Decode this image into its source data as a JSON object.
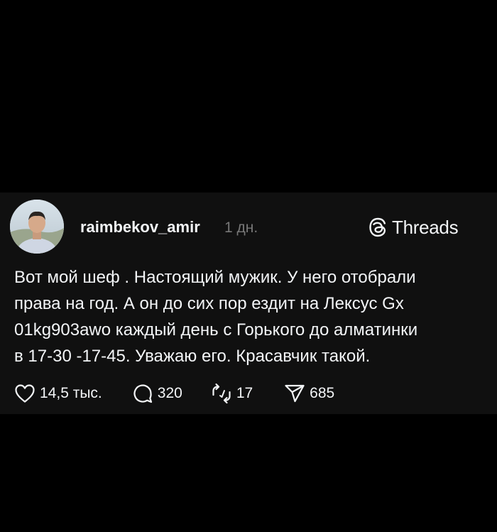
{
  "post": {
    "username": "raimbekov_amir",
    "time": "1 дн.",
    "brand": "Threads",
    "text_lines": [
      "Вот мой шеф . Настоящий мужик. У него отобрали",
      "права на год. А он до сих пор ездит на Лексус Gx",
      "01kg903awo каждый день с Горького до алматинки",
      "в 17-30 -17-45. Уважаю его. Красавчик такой."
    ],
    "stats": {
      "likes": "14,5 тыс.",
      "replies": "320",
      "reposts": "17",
      "shares": "685"
    }
  },
  "icons": {
    "brand": "threads-logo-icon",
    "like": "heart-icon",
    "reply": "comment-bubble-icon",
    "repost": "repost-icon",
    "share": "send-icon"
  },
  "colors": {
    "background": "#000000",
    "card": "#101010",
    "text": "#f3f5f7",
    "muted": "#777777"
  }
}
